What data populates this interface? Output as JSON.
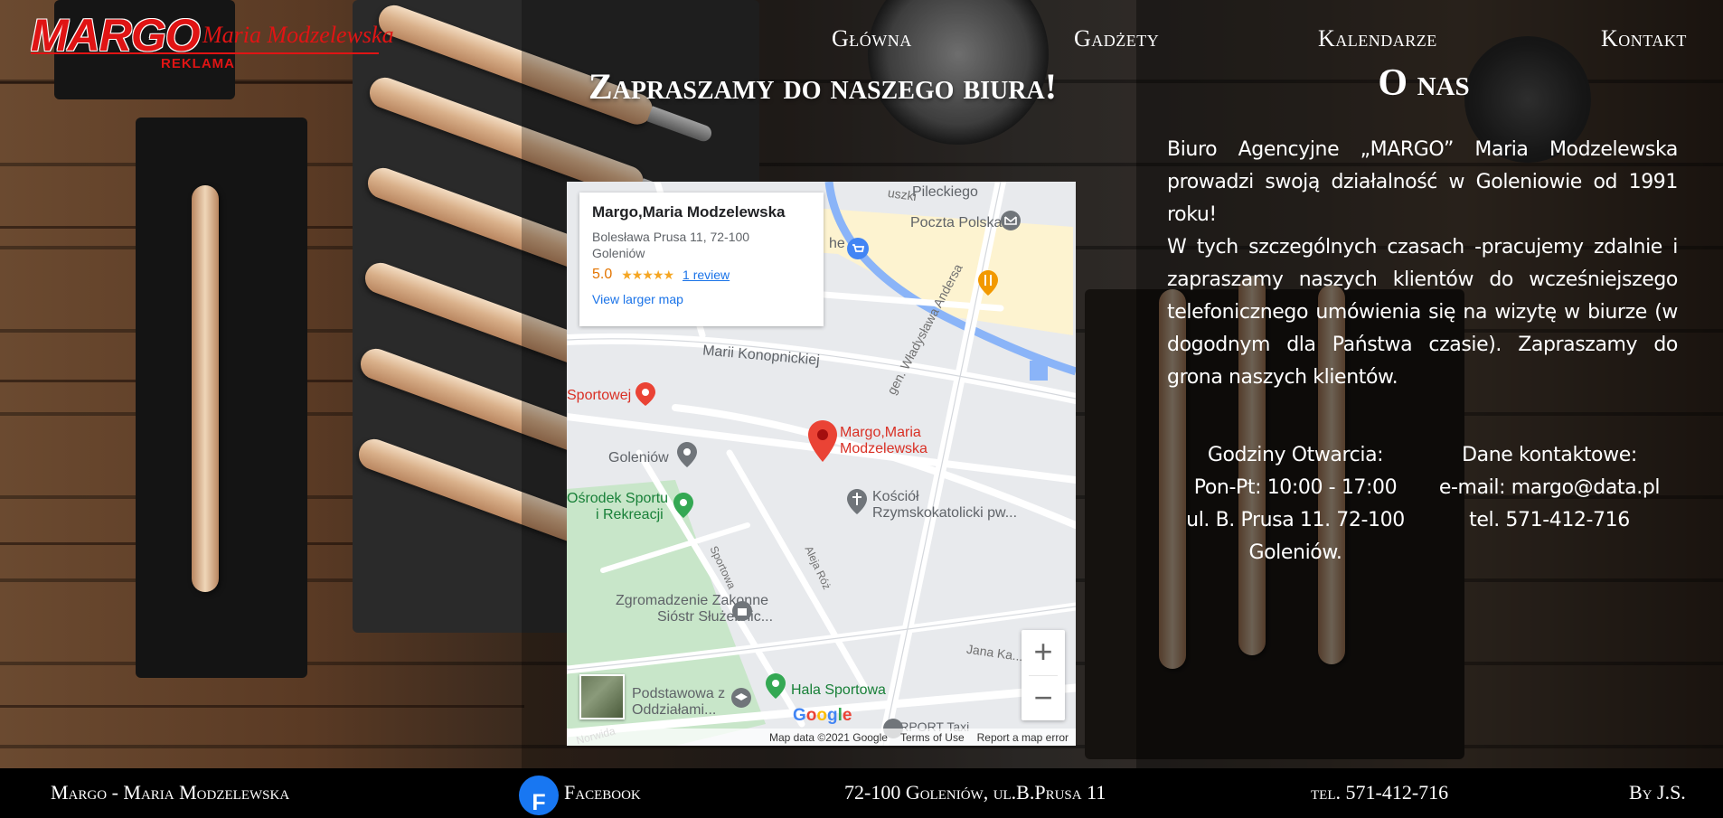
{
  "logo": {
    "brand": "MARGO",
    "owner": "Maria Modzelewska",
    "tagline": "REKLAMA"
  },
  "nav": {
    "items": [
      "Główna",
      "Gadżety",
      "Kalendarze",
      "Kontakt"
    ]
  },
  "center": {
    "title": "Zapraszamy do naszego biura!"
  },
  "map": {
    "card": {
      "name": "Margo,Maria Modzelewska",
      "address": "Bolesława Prusa 11, 72-100 Goleniów",
      "rating": "5.0",
      "stars": "★★★★★",
      "reviews": "1 review",
      "larger_map": "View larger map"
    },
    "labels": {
      "pilecki": "Pileckiego",
      "poczta": "Poczta Polska",
      "konopnickiej": "Marii Konopnickiej",
      "sportowej": "Sportowej",
      "goleniow": "Goleniów",
      "pin_line1": "Margo,Maria",
      "pin_line2": "Modzelewska",
      "anders": "gen. Władysława Andersa",
      "kosciol1": "Kościół",
      "kosciol2": "Rzymskokatolicki pw...",
      "osrodek1": "Ośrodek Sportu",
      "osrodek2": "i Rekreacji",
      "sportowa": "Sportowa",
      "aleja": "Aleja Róż",
      "zgromadzenie1": "Zgromadzenie Zakonne",
      "zgromadzenie2": "Sióstr Służebnic...",
      "jana": "Jana Ka...",
      "podstawowa1": "Podstawowa z",
      "podstawowa2": "Oddziałami...",
      "hala": "Hala Sportowa",
      "airport": "AIRPORT Taxi",
      "norwida": "Norwida",
      "he": "he",
      "uszki": "uszki"
    },
    "zoom_in": "+",
    "zoom_out": "−",
    "google": [
      "G",
      "o",
      "o",
      "g",
      "l",
      "e"
    ],
    "footer": {
      "data": "Map data ©2021 Google",
      "terms": "Terms of Use",
      "report": "Report a map error"
    }
  },
  "about": {
    "title": "O nas",
    "paragraph1": "Biuro Agencyjne „MARGO” Maria Modzelewska prowadzi swoją działalność w Goleniowie od 1991 roku!",
    "paragraph2": "W tych szczególnych czasach -pracujemy zdalnie i zapraszamy naszych klientów do wcześniejszego telefonicznego umówienia się na wizytę w biurze (w dogodnym dla Państwa czasie). Zapraszamy do grona naszych klientów.",
    "hours": {
      "title": "Godziny Otwarcia:",
      "days": "Pon-Pt: 10:00 - 17:00",
      "address1": "ul. B. Prusa 11. 72-100",
      "address2": "Goleniów."
    },
    "contact": {
      "title": "Dane kontaktowe:",
      "email": "e-mail: margo@data.pl",
      "phone": "tel. 571-412-716"
    }
  },
  "footer": {
    "name": "Margo - Maria Modzelewska",
    "facebook": "Facebook",
    "address": "72-100 Goleniów, ul.B.Prusa 11",
    "phone": "tel. 571-412-716",
    "author": "By J.S."
  },
  "colors": {
    "brand_red": "#e01414",
    "map_pin": "#ea4335",
    "link_blue": "#1a73e8",
    "facebook_blue": "#1877f2"
  }
}
